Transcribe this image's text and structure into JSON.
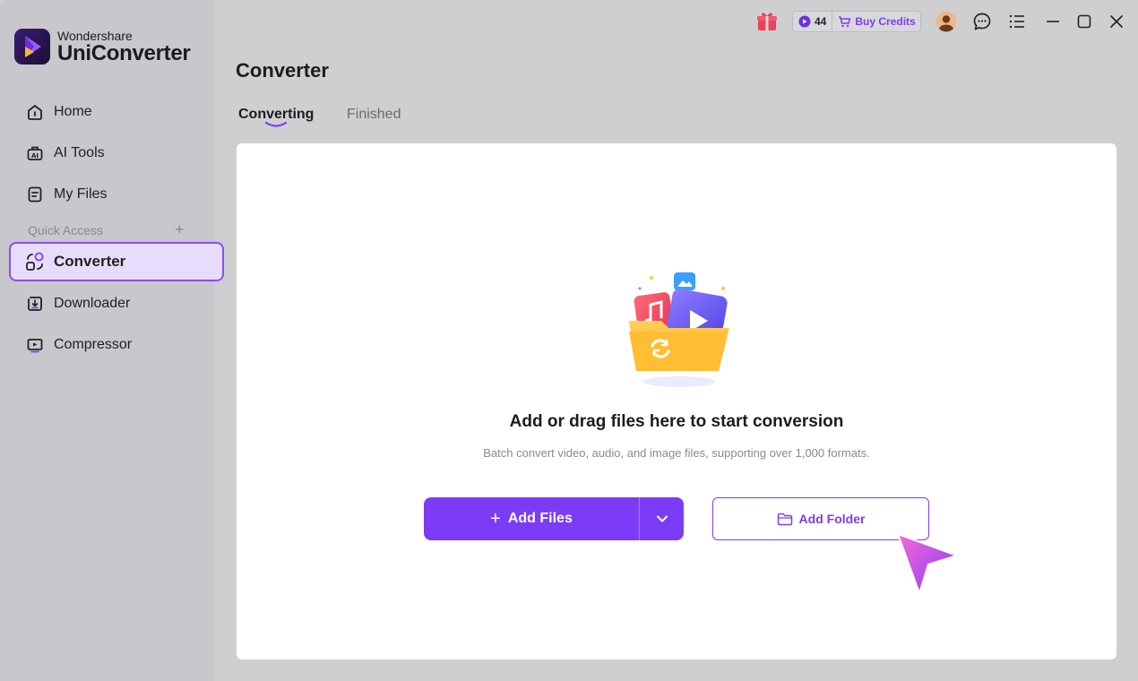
{
  "app": {
    "brand_small": "Wondershare",
    "brand_big": "UniConverter"
  },
  "sidebar": {
    "items": [
      {
        "label": "Home",
        "icon": "home-icon"
      },
      {
        "label": "AI Tools",
        "icon": "ai-tools-icon"
      },
      {
        "label": "My Files",
        "icon": "my-files-icon"
      }
    ],
    "quick_access_label": "Quick Access",
    "quick_items": [
      {
        "label": "Converter",
        "icon": "converter-icon",
        "active": true
      },
      {
        "label": "Downloader",
        "icon": "downloader-icon"
      },
      {
        "label": "Compressor",
        "icon": "compressor-icon"
      }
    ]
  },
  "topbar": {
    "credits_count": "44",
    "buy_credits": "Buy Credits"
  },
  "main": {
    "title": "Converter",
    "tabs": [
      {
        "label": "Converting",
        "active": true
      },
      {
        "label": "Finished",
        "active": false
      }
    ],
    "drop_title": "Add or drag files here to start conversion",
    "drop_subtitle": "Batch convert video, audio, and image files, supporting over 1,000 formats.",
    "add_files_label": "Add Files",
    "add_folder_label": "Add Folder"
  },
  "colors": {
    "accent": "#7c3cf6",
    "active_bg": "#e7dcfb",
    "sidebar_bg": "#c7c7cc",
    "content_bg": "#cfcfd2"
  }
}
